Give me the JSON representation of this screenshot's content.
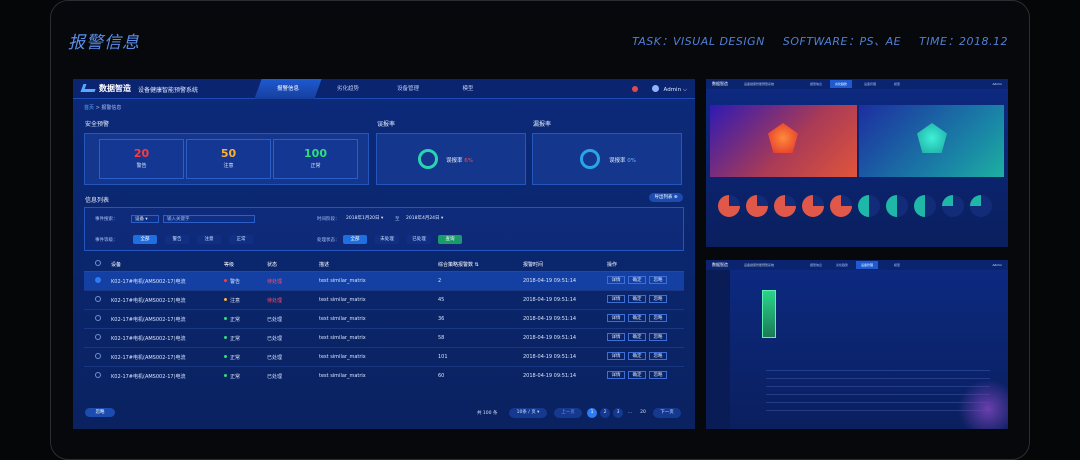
{
  "page": {
    "title": "报警信息",
    "meta": [
      "TASK：VISUAL DESIGN",
      "SOFTWARE：PS、AE",
      "TIME：2018.12"
    ]
  },
  "app": {
    "logo": "数据智造",
    "system_name": "设备健康智能预警系统",
    "nav": [
      "报警信息",
      "劣化趋势",
      "设备管理",
      "模型"
    ],
    "active_nav": 0,
    "user": "Admin"
  },
  "breadcrumb": {
    "home": "首页",
    "current": "报警信息"
  },
  "safety": {
    "label": "安全预警",
    "stats": [
      {
        "value": "20",
        "label": "警告",
        "color": "#ff3b3b"
      },
      {
        "value": "50",
        "label": "注意",
        "color": "#ffb02e"
      },
      {
        "value": "100",
        "label": "正常",
        "color": "#2ee07a"
      }
    ]
  },
  "false_alarm": {
    "label": "误报率",
    "text": "误报率",
    "value": "6%"
  },
  "missed_alarm": {
    "label": "漏报率",
    "text": "误报率",
    "value": "0%"
  },
  "info_list": {
    "label": "信息列表",
    "export_label": "导出列表",
    "filters": {
      "event_search_label": "事件搜索：",
      "event_type": "设备",
      "keyword_placeholder": "输入关键字",
      "time_label": "时间阶段：",
      "date_from": "2018年1月20日",
      "date_sep": "至",
      "date_to": "2018年4月24日",
      "level_label": "事件等级：",
      "levels": [
        "全部",
        "警告",
        "注意",
        "正常"
      ],
      "status_label": "处理状态：",
      "statuses": [
        "全部",
        "未处理",
        "已处理"
      ],
      "query_label": "查询"
    },
    "columns": [
      "设备",
      "等级",
      "状态",
      "描述",
      "综合策略报警数",
      "报警时间",
      "操作"
    ],
    "actions": [
      "详情",
      "确定",
      "忽略"
    ],
    "rows": [
      {
        "device": "K02-17#电机(AMS002-17)电流",
        "level": "警告",
        "level_color": "#ff3b3b",
        "status": "待处理",
        "status_color": "#ff4d6a",
        "desc": "test similar_matrix",
        "count": "2",
        "time": "2018-04-19 09:51:14",
        "selected": true
      },
      {
        "device": "K02-17#电机(AMS002-17)电流",
        "level": "注意",
        "level_color": "#ffb02e",
        "status": "待处理",
        "status_color": "#ff4d6a",
        "desc": "test similar_matrix",
        "count": "45",
        "time": "2018-04-19 09:51:14",
        "selected": false
      },
      {
        "device": "K02-17#电机(AMS002-17)电流",
        "level": "正常",
        "level_color": "#2ee07a",
        "status": "已处理",
        "status_color": "#cfe0ff",
        "desc": "test similar_matrix",
        "count": "36",
        "time": "2018-04-19 09:51:14",
        "selected": false
      },
      {
        "device": "K02-17#电机(AMS002-17)电流",
        "level": "正常",
        "level_color": "#2ee07a",
        "status": "已处理",
        "status_color": "#cfe0ff",
        "desc": "test similar_matrix",
        "count": "58",
        "time": "2018-04-19 09:51:14",
        "selected": false
      },
      {
        "device": "K02-17#电机(AMS002-17)电流",
        "level": "正常",
        "level_color": "#2ee07a",
        "status": "已处理",
        "status_color": "#cfe0ff",
        "desc": "test similar_matrix",
        "count": "101",
        "time": "2018-04-19 09:51:14",
        "selected": false
      },
      {
        "device": "K02-17#电机(AMS002-17)电流",
        "level": "正常",
        "level_color": "#2ee07a",
        "status": "已处理",
        "status_color": "#cfe0ff",
        "desc": "test similar_matrix",
        "count": "60",
        "time": "2018-04-19 09:51:14",
        "selected": false
      }
    ],
    "footer_button": "忽略",
    "pagination": {
      "total": "共 100 条",
      "page_size": "10条 / 页",
      "prev": "上一页",
      "pages": [
        "1",
        "2",
        "3",
        "...",
        "20"
      ],
      "current": "1",
      "next": "下一页"
    }
  },
  "thumb1": {
    "logo": "数据智造",
    "system": "设备健康智能预警系统",
    "nav": [
      "报警信息",
      "劣化趋势",
      "设备管理",
      "模型"
    ],
    "user": "Admin"
  },
  "thumb2": {
    "logo": "数据智造",
    "system": "设备健康智能预警系统",
    "nav": [
      "报警信息",
      "劣化趋势",
      "设备管理",
      "模型"
    ],
    "user": "Admin"
  }
}
